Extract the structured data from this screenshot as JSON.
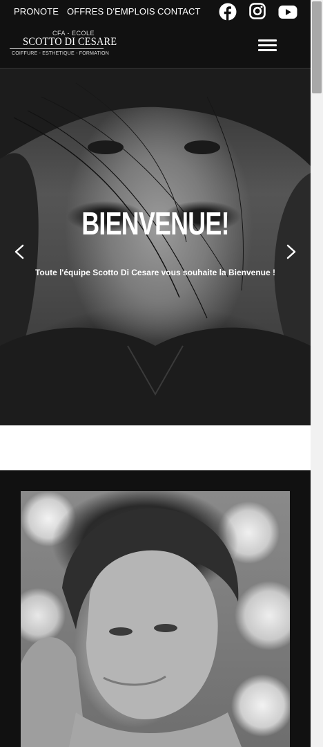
{
  "topnav": {
    "items": [
      "PRONOTE",
      "OFFRES D'EMPLOIS",
      "CONTACT"
    ]
  },
  "social": {
    "icons": [
      "facebook-icon",
      "instagram-icon",
      "youtube-icon"
    ]
  },
  "logo": {
    "sup": "CFA - ECOLE",
    "main": "SCOTTO DI CESARE",
    "sub": "COIFFURE - ESTHETIQUE - FORMATION"
  },
  "menu": {
    "icon": "hamburger-icon"
  },
  "hero": {
    "title": "BIENVENUE!",
    "subtitle": "Toute l'équipe Scotto Di Cesare vous souhaite la Bienvenue !",
    "prev_icon": "chevron-left-icon",
    "next_icon": "chevron-right-icon"
  },
  "colors": {
    "header_bg": "#111111",
    "band_bg": "#111111",
    "text": "#ffffff"
  }
}
